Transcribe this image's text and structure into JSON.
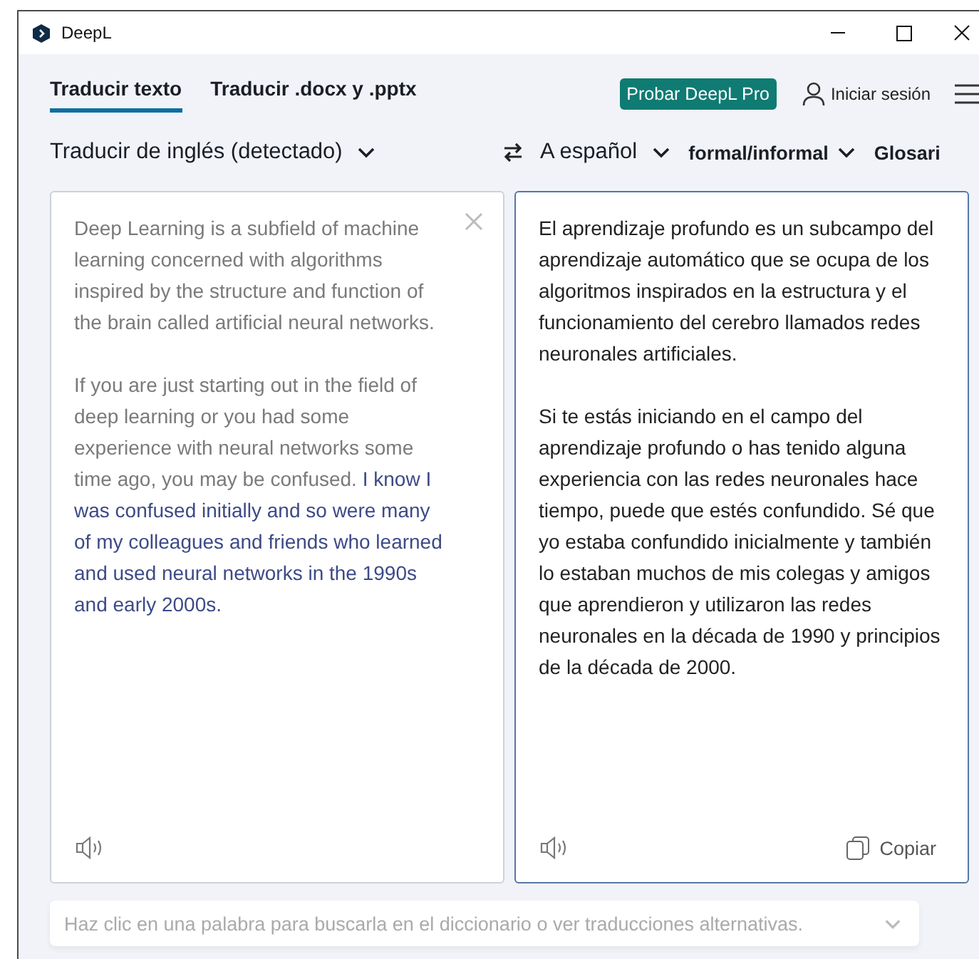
{
  "window": {
    "title": "DeepL"
  },
  "tabs": [
    {
      "label": "Traducir texto",
      "selected": true
    },
    {
      "label": "Traducir .docx y .pptx",
      "selected": false
    }
  ],
  "pro_button": "Probar DeepL Pro",
  "sign_in": "Iniciar sesión",
  "source_language": "Traducir de inglés (detectado)",
  "target_language": "A español",
  "formality": "formal/informal",
  "glossary": "Glosari",
  "source": {
    "focused": false,
    "paragraphs": [
      [
        {
          "text": "Deep Learning is a subfield of machine learning concerned with algorithms inspired by the structure and function of the brain called artificial neural networks.",
          "highlighted": false
        }
      ],
      [
        {
          "text": "If you are just starting out in the field of deep learning or you had some experience with neural networks some time ago, you may be confused.",
          "highlighted": false
        },
        {
          "text": " I know I was confused initially and so were many of my colleagues and friends who learned and used neural networks in the 1990s and early 2000s.",
          "highlighted": true
        }
      ]
    ]
  },
  "target": {
    "focused": true,
    "paragraphs": [
      [
        {
          "text": "El aprendizaje profundo es un subcampo del aprendizaje automático que se ocupa de los algoritmos inspirados en la estructura y el funcionamiento del cerebro llamados redes neuronales artificiales.",
          "highlighted": false
        }
      ],
      [
        {
          "text": "Si te estás iniciando en el campo del aprendizaje profundo o has tenido alguna experiencia con las redes neuronales hace tiempo, puede que estés confundido. Sé que yo estaba confundido inicialmente y también lo estaban muchos de mis colegas y amigos que aprendieron y utilizaron las redes neuronales en la década de 1990 y principios de la década de 2000.",
          "highlighted": false
        }
      ]
    ],
    "copy_label": "Copiar"
  },
  "dictionary": {
    "placeholder": "Haz clic en una palabra para buscarla en el diccionario o ver traducciones alternativas."
  }
}
